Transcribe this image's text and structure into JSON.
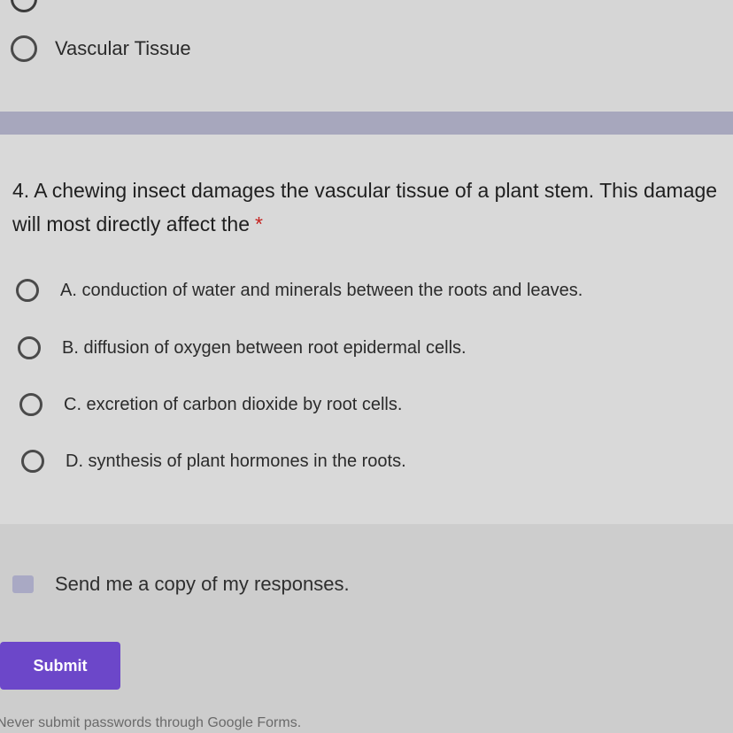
{
  "previous_question": {
    "option_label": "Vascular Tissue"
  },
  "question": {
    "text": "4. A chewing insect damages the vascular tissue of a plant stem. This damage will most directly affect the",
    "required_marker": "*",
    "options": [
      {
        "label": "A. conduction of water and minerals between the roots and leaves."
      },
      {
        "label": "B. diffusion of oxygen between root epidermal cells."
      },
      {
        "label": "C. excretion of carbon dioxide by root cells."
      },
      {
        "label": "D. synthesis of plant hormones in the roots."
      }
    ]
  },
  "footer": {
    "copy_responses_label": "Send me a copy of my responses.",
    "submit_label": "Submit",
    "warning_text": "Never submit passwords through Google Forms."
  },
  "colors": {
    "accent": "#6c47c9",
    "required": "#c5221f",
    "divider": "#a7a7bd"
  }
}
